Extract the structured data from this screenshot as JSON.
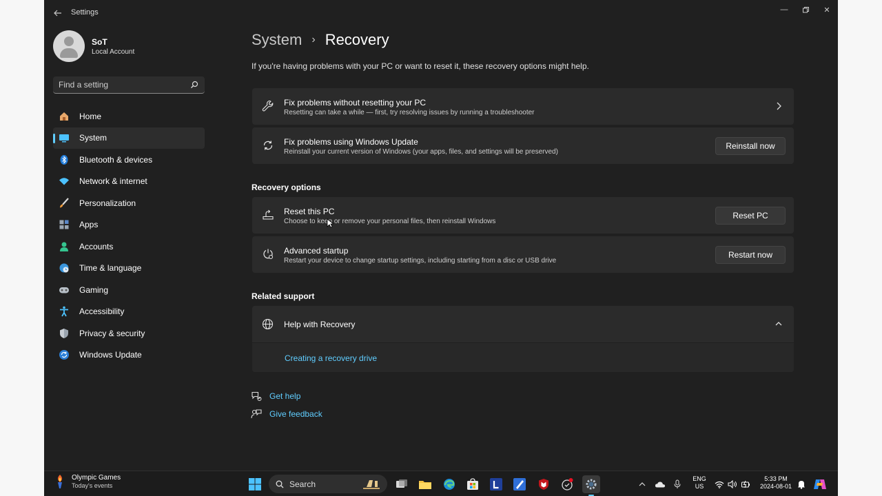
{
  "window": {
    "title": "Settings",
    "controls": {
      "minimize": "—",
      "maximize": "▢",
      "close": "✕"
    }
  },
  "profile": {
    "name": "SoT",
    "account_type": "Local Account"
  },
  "search": {
    "placeholder": "Find a setting"
  },
  "sidebar": {
    "items": [
      {
        "label": "Home",
        "icon": "home-icon"
      },
      {
        "label": "System",
        "icon": "system-icon",
        "active": true
      },
      {
        "label": "Bluetooth & devices",
        "icon": "bluetooth-icon"
      },
      {
        "label": "Network & internet",
        "icon": "wifi-icon"
      },
      {
        "label": "Personalization",
        "icon": "brush-icon"
      },
      {
        "label": "Apps",
        "icon": "apps-icon"
      },
      {
        "label": "Accounts",
        "icon": "accounts-icon"
      },
      {
        "label": "Time & language",
        "icon": "globe-clock-icon"
      },
      {
        "label": "Gaming",
        "icon": "gamepad-icon"
      },
      {
        "label": "Accessibility",
        "icon": "accessibility-icon"
      },
      {
        "label": "Privacy & security",
        "icon": "shield-icon"
      },
      {
        "label": "Windows Update",
        "icon": "update-icon"
      }
    ]
  },
  "breadcrumb": {
    "parent": "System",
    "separator": "›",
    "current": "Recovery"
  },
  "intro": "If you're having problems with your PC or want to reset it, these recovery options might help.",
  "cards": {
    "fix_no_reset": {
      "title": "Fix problems without resetting your PC",
      "subtitle": "Resetting can take a while — first, try resolving issues by running a troubleshooter"
    },
    "fix_update": {
      "title": "Fix problems using Windows Update",
      "subtitle": "Reinstall your current version of Windows (your apps, files, and settings will be preserved)",
      "button": "Reinstall now"
    }
  },
  "recovery_options": {
    "heading": "Recovery options",
    "reset": {
      "title": "Reset this PC",
      "subtitle": "Choose to keep or remove your personal files, then reinstall Windows",
      "button": "Reset PC"
    },
    "advanced": {
      "title": "Advanced startup",
      "subtitle": "Restart your device to change startup settings, including starting from a disc or USB drive",
      "button": "Restart now"
    }
  },
  "related_support": {
    "heading": "Related support",
    "help_title": "Help with Recovery",
    "link": "Creating a recovery drive"
  },
  "footer_links": {
    "get_help": "Get help",
    "give_feedback": "Give feedback"
  },
  "taskbar": {
    "widget_title": "Olympic Games",
    "widget_sub": "Today's events",
    "search": "Search",
    "lang_top": "ENG",
    "lang_bottom": "US",
    "time": "5:33 PM",
    "date": "2024-08-01"
  },
  "colors": {
    "accent": "#60cdff",
    "background": "#202020",
    "card": "#2b2b2b"
  }
}
